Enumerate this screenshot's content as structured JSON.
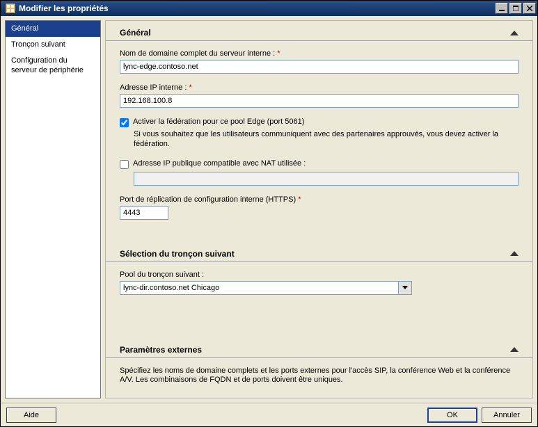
{
  "window": {
    "title": "Modifier les propriétés"
  },
  "sidebar": {
    "items": [
      {
        "label": "Général"
      },
      {
        "label": "Tronçon suivant"
      },
      {
        "label": "Configuration du serveur de périphérie"
      }
    ]
  },
  "sections": {
    "general": {
      "title": "Général",
      "fqdn_label": "Nom de domaine complet du serveur interne :",
      "fqdn_value": "lync-edge.contoso.net",
      "ip_label": "Adresse IP interne :",
      "ip_value": "192.168.100.8",
      "fed_checkbox_label": "Activer la fédération pour ce pool Edge (port 5061)",
      "fed_desc": "Si vous souhaitez que les utilisateurs communiquent avec des partenaires approuvés, vous devez activer la fédération.",
      "nat_checkbox_label": "Adresse IP publique compatible avec NAT utilisée :",
      "nat_value": "",
      "repl_port_label": "Port de réplication de configuration interne (HTTPS)",
      "repl_port_value": "4443"
    },
    "next_hop": {
      "title": "Sélection du tronçon suivant",
      "pool_label": "Pool du tronçon suivant :",
      "pool_value": "lync-dir.contoso.net   Chicago"
    },
    "external": {
      "title": "Paramètres externes",
      "desc": "Spécifiez les noms de domaine complets et les ports externes pour l'accès SIP, la conférence Web et la conférence A/V. Les combinaisons de FQDN et de ports doivent être uniques."
    }
  },
  "required_marker": "*",
  "buttons": {
    "help": "Aide",
    "ok": "OK",
    "cancel": "Annuler"
  }
}
